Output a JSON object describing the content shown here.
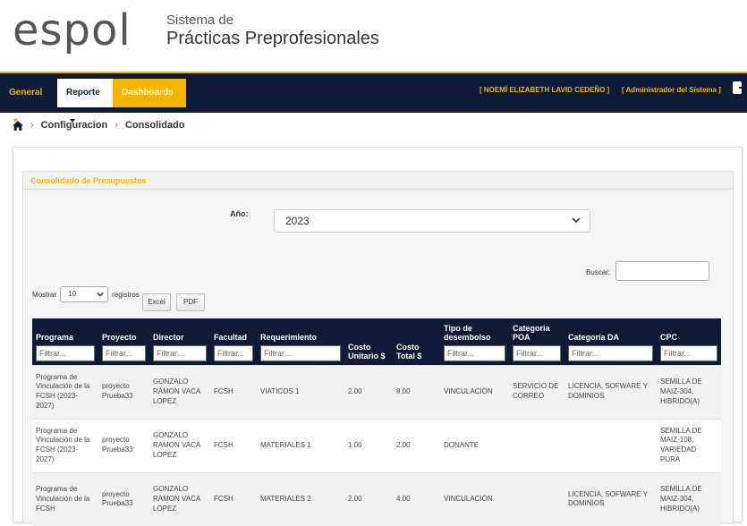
{
  "brand": {
    "logo": "espol",
    "title_line1": "Sistema de",
    "title_line2": "Prácticas Preprofesionales"
  },
  "navbar": {
    "items": [
      {
        "label": "General"
      },
      {
        "label": "Reporte"
      },
      {
        "label": "Dashboards"
      }
    ],
    "user": "[ NOEMÍ ELIZABETH LAVID CEDEÑO ]",
    "role": "[ Administrador del Sistema ]"
  },
  "breadcrumb": {
    "items": [
      "Configuracion",
      "Consolidado"
    ]
  },
  "panel": {
    "title": "Consolidado de Presupuestos",
    "anio_label": "Año:",
    "anio_value": "2023",
    "buscar_label": "Buscar:",
    "mostrar_label": "Mostrar",
    "mostrar_value": "10",
    "registros_label": "registros",
    "excel_label": "Excel",
    "pdf_label": "PDF"
  },
  "table": {
    "filter_placeholder": "Filtrar...",
    "columns": [
      {
        "label": "Programa"
      },
      {
        "label": "Proyecto"
      },
      {
        "label": "Director"
      },
      {
        "label": "Facultad"
      },
      {
        "label": "Requerimiento"
      },
      {
        "label": "Costo Unitario $"
      },
      {
        "label": "Costo Total $"
      },
      {
        "label": "Tipo de desembolso"
      },
      {
        "label": "Categoria POA"
      },
      {
        "label": "Categoría DA"
      },
      {
        "label": "CPC"
      }
    ],
    "rows": [
      [
        "Programa de Vinculación de la FCSH (2023-2027)",
        "proyecto Prueba33",
        "GONZALO RAMON VACA LOPEZ",
        "FCSH",
        "VIATICOS 1",
        "2.00",
        "8.00",
        "VINCULACIÓN",
        "SERVICIO DE CORREO",
        "LICENCIA, SOFWARE Y DOMINIOS",
        "SEMILLA DE MAIZ-304, HIBRIDO(A)"
      ],
      [
        "Programa de Vinculación de la FCSH (2023-2027)",
        "proyecto Prueba33",
        "GONZALO RAMON VACA LOPEZ",
        "FCSH",
        "MATERIALES 1",
        "1.00",
        "2.00",
        "DONANTE",
        "",
        "",
        "SEMILLA DE MAIZ-108, VARIEDAD PURA"
      ],
      [
        "Programa de Vinculación de la FCSH",
        "proyecto Prueba33",
        "GONZALO RAMON VACA LOPEZ",
        "FCSH",
        "MATERIALES 2",
        "2.00",
        "4.00",
        "VINCULACIÓN",
        "",
        "LICENCIA, SOFWARE Y DOMINIOS",
        "SEMILLA DE MAIZ-304, HIBRIDO(A)"
      ]
    ]
  },
  "colors": {
    "navy": "#0d1b36",
    "gold": "#f4b400"
  }
}
